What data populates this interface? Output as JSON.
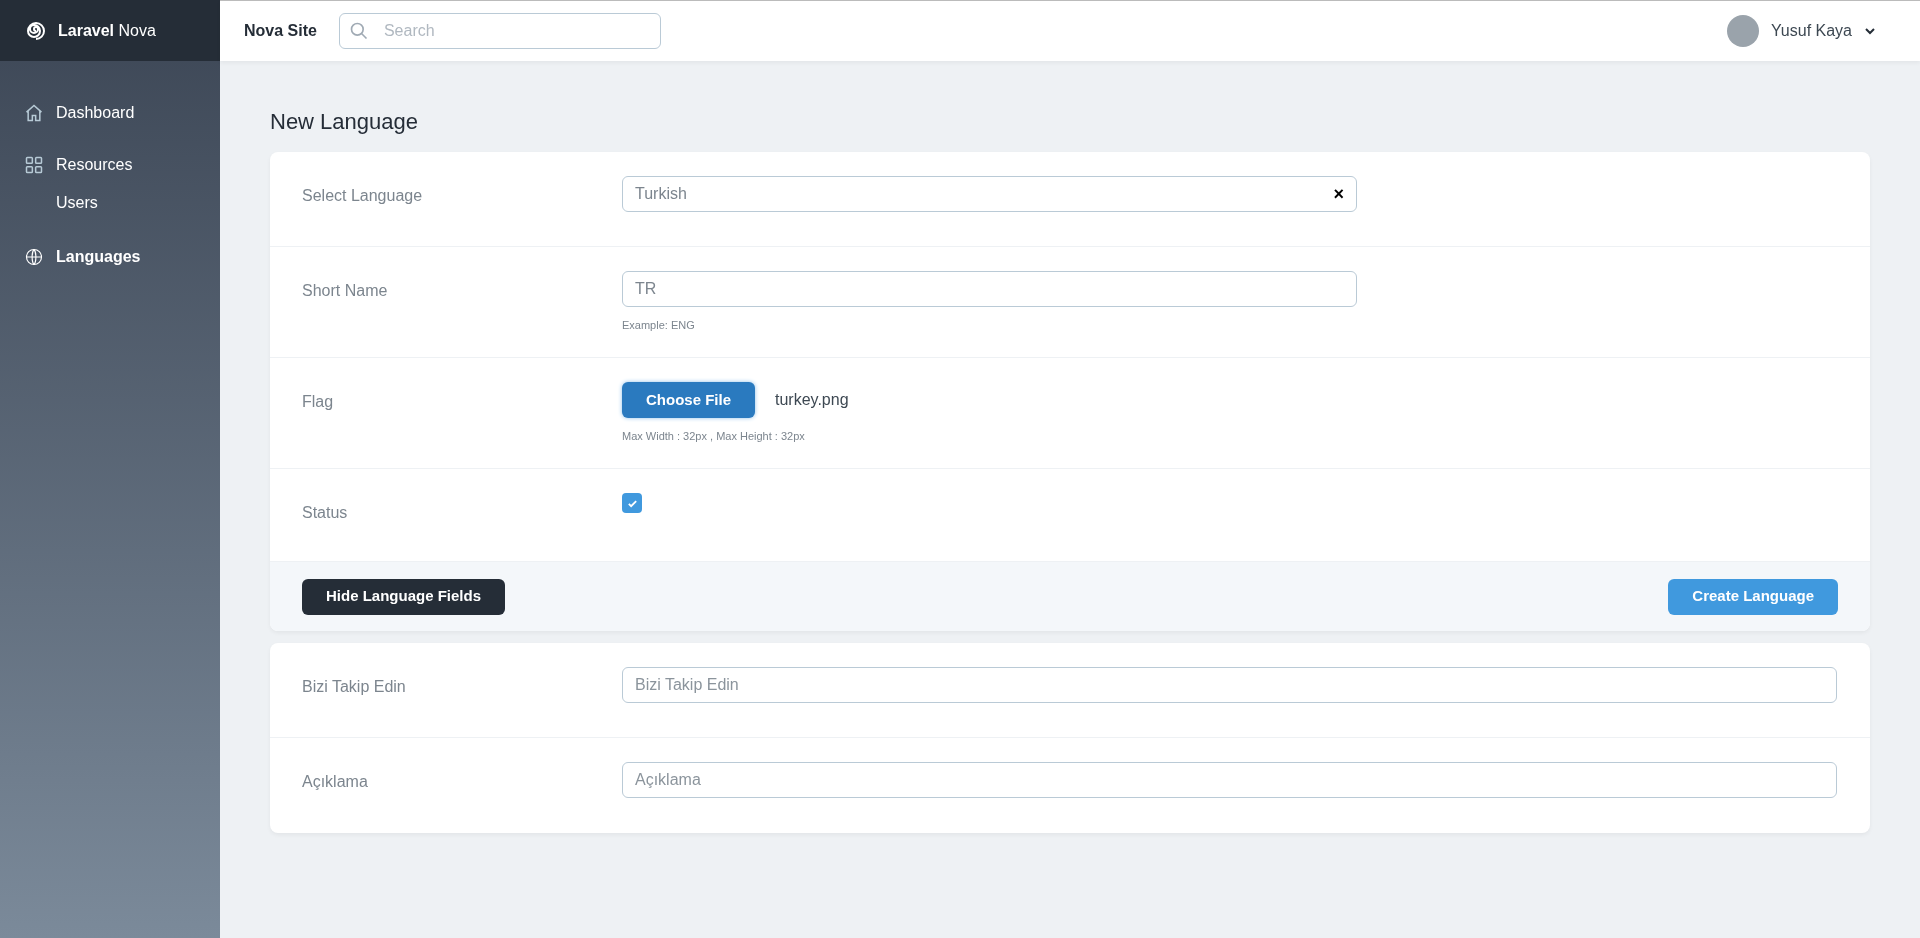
{
  "brand": {
    "name_bold": "Laravel",
    "name_light": "Nova"
  },
  "header": {
    "site": "Nova Site",
    "search": {
      "placeholder": "Search"
    },
    "user": {
      "name": "Yusuf Kaya"
    }
  },
  "sidebar": {
    "items": [
      {
        "kind": "home",
        "label": "Dashboard",
        "selected": false
      },
      {
        "kind": "grid",
        "label": "Resources",
        "selected": false,
        "children": [
          {
            "label": "Users",
            "selected": false
          }
        ]
      },
      {
        "kind": "globe",
        "label": "Languages",
        "selected": true
      }
    ]
  },
  "page_title": "New Language",
  "form": {
    "fields": [
      {
        "kind": "select",
        "label": "Select Language",
        "value": "Turkish",
        "clear": "×"
      },
      {
        "kind": "text",
        "label": "Short Name",
        "value": "TR",
        "help": "Example: ENG"
      },
      {
        "kind": "file",
        "label": "Flag",
        "button": "Choose File",
        "file_name": "turkey.png",
        "help": "Max Width : 32px , Max Height : 32px"
      },
      {
        "kind": "checkbox",
        "label": "Status",
        "checked": true
      }
    ],
    "secondary_button": "Hide Language Fields",
    "primary_button": "Create Language"
  },
  "extra_form": {
    "fields": [
      {
        "kind": "text",
        "label": "Bizi Takip Edin",
        "placeholder": "Bizi Takip Edin"
      },
      {
        "kind": "text",
        "label": "Açıklama",
        "placeholder": "Açıklama"
      }
    ]
  }
}
